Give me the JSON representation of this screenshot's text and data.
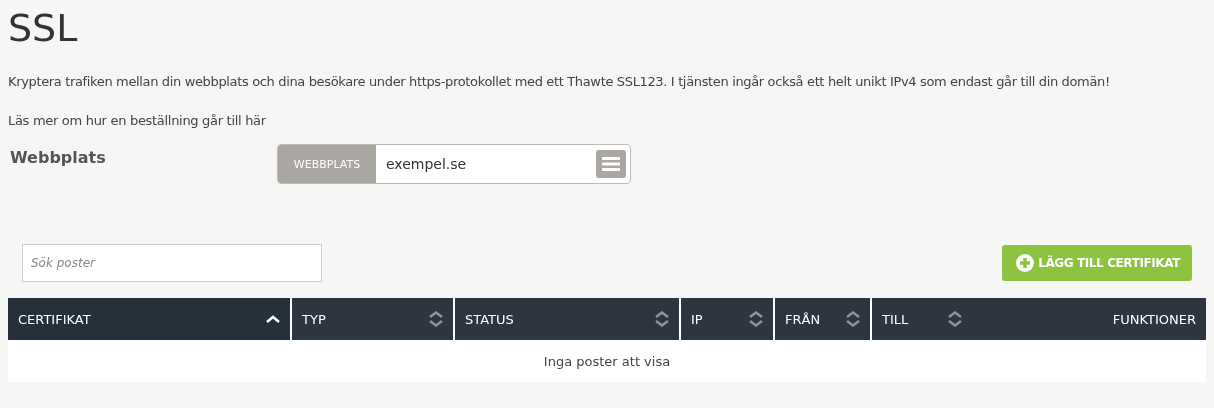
{
  "title": "SSL",
  "intro": "Kryptera trafiken mellan din webbplats och dina besökare under https-protokollet med ett Thawte SSL123. I tjänsten ingår också ett helt unikt IPv4 som endast går till din domän!",
  "read_more": "Läs mer om hur en beställning går till här",
  "site": {
    "label": "Webbplats",
    "addon": "WEBBPLATS",
    "value": "exempel.se"
  },
  "search": {
    "placeholder": "Sök poster"
  },
  "add_button": "LÄGG TILL CERTIFIKAT",
  "table": {
    "columns": [
      {
        "label": "CERTIFIKAT",
        "sortable": true,
        "sorted": true
      },
      {
        "label": "TYP",
        "sortable": true,
        "sorted": false
      },
      {
        "label": "STATUS",
        "sortable": true,
        "sorted": false
      },
      {
        "label": "IP",
        "sortable": true,
        "sorted": false
      },
      {
        "label": "FRÅN",
        "sortable": true,
        "sorted": false
      },
      {
        "label": "TILL",
        "sortable": true,
        "sorted": false
      },
      {
        "label": "FUNKTIONER",
        "sortable": false
      }
    ],
    "empty": "Inga poster att visa"
  }
}
